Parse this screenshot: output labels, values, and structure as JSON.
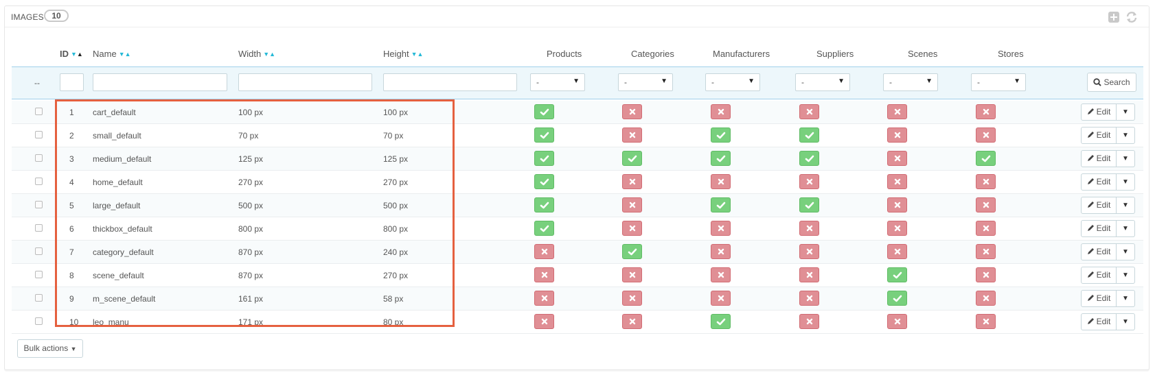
{
  "panel": {
    "title": "IMAGES",
    "count": "10",
    "tools": {
      "add_icon": "plus-square-icon",
      "refresh_icon": "refresh-icon"
    }
  },
  "table": {
    "headers": {
      "id": "ID",
      "name": "Name",
      "width": "Width",
      "height": "Height",
      "products": "Products",
      "categories": "Categories",
      "manufacturers": "Manufacturers",
      "suppliers": "Suppliers",
      "scenes": "Scenes",
      "stores": "Stores"
    },
    "filters": {
      "dash": "--",
      "select_value": "-",
      "search_label": "Search"
    },
    "rows": [
      {
        "id": "1",
        "name": "cart_default",
        "width": "100 px",
        "height": "100 px",
        "products": true,
        "categories": false,
        "manufacturers": false,
        "suppliers": false,
        "scenes": false,
        "stores": false
      },
      {
        "id": "2",
        "name": "small_default",
        "width": "70 px",
        "height": "70 px",
        "products": true,
        "categories": false,
        "manufacturers": true,
        "suppliers": true,
        "scenes": false,
        "stores": false
      },
      {
        "id": "3",
        "name": "medium_default",
        "width": "125 px",
        "height": "125 px",
        "products": true,
        "categories": true,
        "manufacturers": true,
        "suppliers": true,
        "scenes": false,
        "stores": true
      },
      {
        "id": "4",
        "name": "home_default",
        "width": "270 px",
        "height": "270 px",
        "products": true,
        "categories": false,
        "manufacturers": false,
        "suppliers": false,
        "scenes": false,
        "stores": false
      },
      {
        "id": "5",
        "name": "large_default",
        "width": "500 px",
        "height": "500 px",
        "products": true,
        "categories": false,
        "manufacturers": true,
        "suppliers": true,
        "scenes": false,
        "stores": false
      },
      {
        "id": "6",
        "name": "thickbox_default",
        "width": "800 px",
        "height": "800 px",
        "products": true,
        "categories": false,
        "manufacturers": false,
        "suppliers": false,
        "scenes": false,
        "stores": false
      },
      {
        "id": "7",
        "name": "category_default",
        "width": "870 px",
        "height": "240 px",
        "products": false,
        "categories": true,
        "manufacturers": false,
        "suppliers": false,
        "scenes": false,
        "stores": false
      },
      {
        "id": "8",
        "name": "scene_default",
        "width": "870 px",
        "height": "270 px",
        "products": false,
        "categories": false,
        "manufacturers": false,
        "suppliers": false,
        "scenes": true,
        "stores": false
      },
      {
        "id": "9",
        "name": "m_scene_default",
        "width": "161 px",
        "height": "58 px",
        "products": false,
        "categories": false,
        "manufacturers": false,
        "suppliers": false,
        "scenes": true,
        "stores": false
      },
      {
        "id": "10",
        "name": "leo_manu",
        "width": "171 px",
        "height": "80 px",
        "products": false,
        "categories": false,
        "manufacturers": true,
        "suppliers": false,
        "scenes": false,
        "stores": false
      }
    ],
    "row_action": {
      "edit_label": "Edit"
    }
  },
  "footer": {
    "bulk_actions_label": "Bulk actions"
  },
  "colors": {
    "yes": "#78d07d",
    "no": "#e08f95",
    "highlight": "#e5603f",
    "accent": "#25b9d7"
  }
}
